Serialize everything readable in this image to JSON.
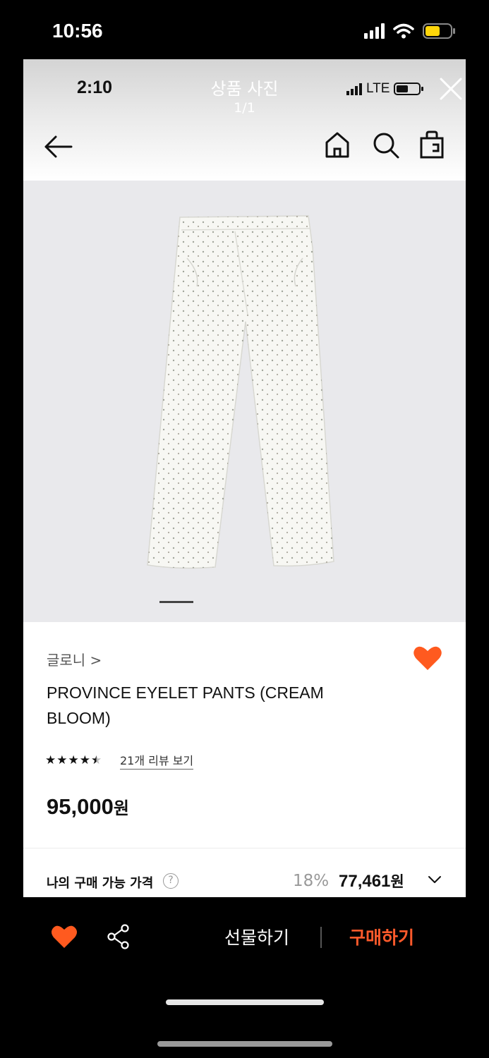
{
  "outer_status": {
    "time": "10:56"
  },
  "inner_status": {
    "time": "2:10",
    "network": "LTE"
  },
  "photo_viewer": {
    "title": "상품 사진",
    "count": "1/1"
  },
  "product": {
    "brand": "글로니 >",
    "name": "PROVINCE EYELET PANTS (CREAM BLOOM)",
    "rating": 4.5,
    "rating_stars": "★★★★½",
    "review_link": "21개 리뷰 보기",
    "price_number": "95,000",
    "price_unit": "원"
  },
  "my_price": {
    "label": "나의 구매 가능 가격",
    "help": "?",
    "discount": "18%",
    "price_number": "77,461",
    "price_unit": "원"
  },
  "bottom_bar": {
    "gift_label": "선물하기",
    "buy_label": "구매하기"
  },
  "colors": {
    "accent": "#ff5a2b",
    "heart": "#ff5a1f"
  },
  "image_indicator_position": 1
}
